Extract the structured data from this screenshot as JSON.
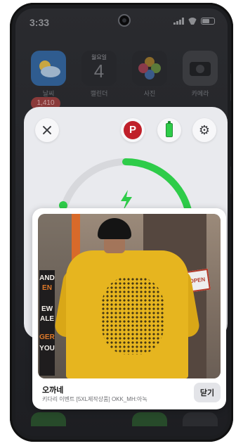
{
  "status_bar": {
    "time": "3:33"
  },
  "home": {
    "apps": [
      {
        "label": "날씨",
        "icon": "weather-icon",
        "color": "#2f5c8f"
      },
      {
        "label": "캘린더",
        "icon": "calendar-icon",
        "color": "#2b2c30",
        "weekday": "월요일",
        "day": "4"
      },
      {
        "label": "사진",
        "icon": "photos-icon",
        "color": "#2b2c30"
      },
      {
        "label": "카메라",
        "icon": "camera-icon",
        "color": "#3a3b3f"
      }
    ],
    "badge": "1,410"
  },
  "widget": {
    "battery_progress": 0.4,
    "accent": "#2ecc49"
  },
  "popup": {
    "store_name": "오까네",
    "description": "키다리 이벤트 [5XL제작상품] OKK_MH:아녹",
    "close_label": "닫기",
    "photo": {
      "poster_lines": [
        "AND",
        "EN",
        "EW",
        "ALE",
        "GER",
        "YOU"
      ],
      "sign_text": "OPEN"
    }
  }
}
